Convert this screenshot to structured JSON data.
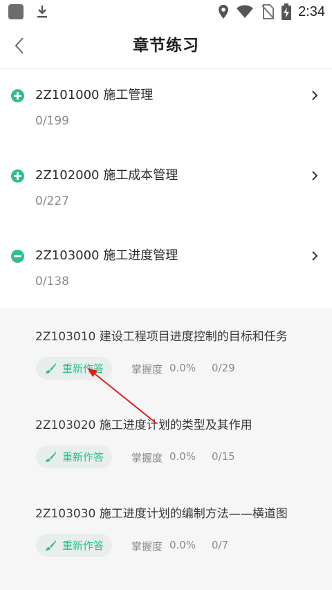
{
  "status_bar": {
    "time": "2:34",
    "icons": [
      "app-square-icon",
      "download-icon",
      "location-icon",
      "wifi-icon",
      "no-sim-icon",
      "battery-charging-icon"
    ]
  },
  "header": {
    "title": "章节练习",
    "back_icon": "chevron-left-icon"
  },
  "chapters": [
    {
      "code_title": "2Z101000 施工管理",
      "progress": "0/199",
      "expanded": false
    },
    {
      "code_title": "2Z102000 施工成本管理",
      "progress": "0/227",
      "expanded": false
    },
    {
      "code_title": "2Z103000 施工进度管理",
      "progress": "0/138",
      "expanded": true
    }
  ],
  "sections": [
    {
      "title": "2Z103010 建设工程项目进度控制的目标和任务",
      "button": "重新作答",
      "mastery_label": "掌握度",
      "mastery": "0.0%",
      "progress": "0/29"
    },
    {
      "title": "2Z103020 施工进度计划的类型及其作用",
      "button": "重新作答",
      "mastery_label": "掌握度",
      "mastery": "0.0%",
      "progress": "0/15"
    },
    {
      "title": "2Z103030 施工进度计划的编制方法——横道图",
      "button": "重新作答",
      "mastery_label": "掌握度",
      "mastery": "0.0%",
      "progress": "0/7"
    }
  ],
  "colors": {
    "accent": "#2fbf8e",
    "annotation_arrow": "#e01b1b"
  }
}
